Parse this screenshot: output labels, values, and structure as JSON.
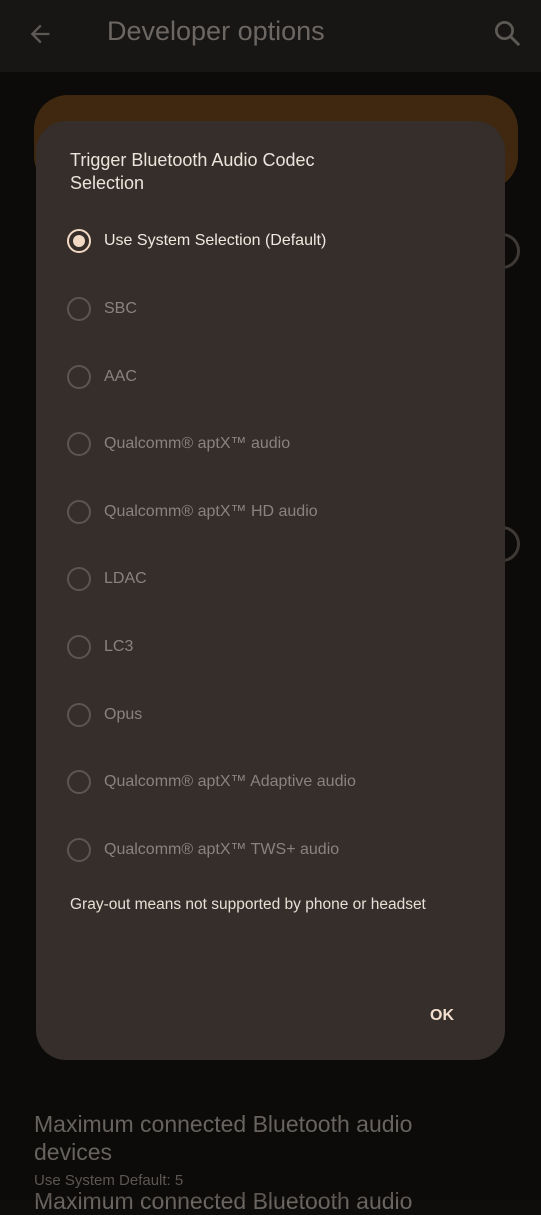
{
  "app_bar": {
    "title": "Developer options",
    "back_icon": "arrow-back-icon",
    "search_icon": "search-icon"
  },
  "background": {
    "max_devices_title": "Maximum connected Bluetooth audio devices",
    "max_devices_subtitle": "Use System Default: 5",
    "next_item_title": "Maximum connected Bluetooth audio"
  },
  "dialog": {
    "title": "Trigger Bluetooth Audio Codec Selection",
    "options": [
      {
        "label": "Use System Selection (Default)",
        "selected": true,
        "enabled": true
      },
      {
        "label": "SBC",
        "selected": false,
        "enabled": false
      },
      {
        "label": "AAC",
        "selected": false,
        "enabled": false
      },
      {
        "label": "Qualcomm® aptX™ audio",
        "selected": false,
        "enabled": false
      },
      {
        "label": "Qualcomm® aptX™ HD audio",
        "selected": false,
        "enabled": false
      },
      {
        "label": "LDAC",
        "selected": false,
        "enabled": false
      },
      {
        "label": "LC3",
        "selected": false,
        "enabled": false
      },
      {
        "label": "Opus",
        "selected": false,
        "enabled": false
      },
      {
        "label": "Qualcomm® aptX™ Adaptive audio",
        "selected": false,
        "enabled": false
      },
      {
        "label": "Qualcomm® aptX™ TWS+ audio",
        "selected": false,
        "enabled": false
      }
    ],
    "note": "Gray-out means not supported by phone or headset",
    "ok_label": "OK"
  },
  "colors": {
    "dialog_bg": "#352e2a",
    "accent": "#f2d9c4",
    "disabled_text": "#8a837d"
  }
}
